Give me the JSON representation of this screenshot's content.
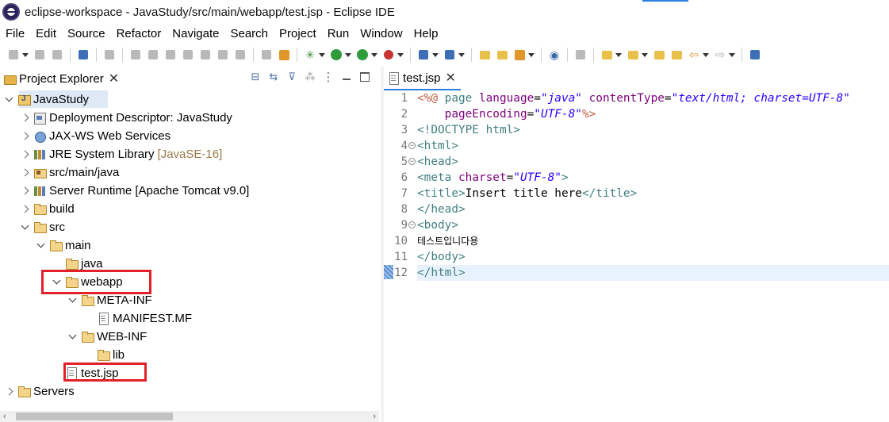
{
  "window": {
    "title": "eclipse-workspace - JavaStudy/src/main/webapp/test.jsp - Eclipse IDE"
  },
  "menu": [
    "File",
    "Edit",
    "Source",
    "Refactor",
    "Navigate",
    "Search",
    "Project",
    "Run",
    "Window",
    "Help"
  ],
  "project_explorer": {
    "tab_label": "Project Explorer",
    "tree": [
      {
        "label": "JavaStudy",
        "icon": "java-project-icon",
        "expanded": true,
        "selected": true
      },
      {
        "label": "Deployment Descriptor: JavaStudy",
        "icon": "deployment-descriptor-icon"
      },
      {
        "label": "JAX-WS Web Services",
        "icon": "web-services-icon"
      },
      {
        "label": "JRE System Library",
        "suffix": "[JavaSE-16]",
        "icon": "library-icon"
      },
      {
        "label": "src/main/java",
        "icon": "source-folder-icon"
      },
      {
        "label": "Server Runtime [Apache Tomcat v9.0]",
        "icon": "library-icon"
      },
      {
        "label": "build",
        "icon": "folder-icon"
      },
      {
        "label": "src",
        "icon": "folder-icon",
        "expanded": true
      },
      {
        "label": "main",
        "icon": "folder-icon",
        "expanded": true
      },
      {
        "label": "java",
        "icon": "folder-icon"
      },
      {
        "label": "webapp",
        "icon": "folder-icon",
        "expanded": true,
        "highlighted": true
      },
      {
        "label": "META-INF",
        "icon": "folder-icon",
        "expanded": true
      },
      {
        "label": "MANIFEST.MF",
        "icon": "file-icon"
      },
      {
        "label": "WEB-INF",
        "icon": "folder-icon",
        "expanded": true
      },
      {
        "label": "lib",
        "icon": "folder-icon"
      },
      {
        "label": "test.jsp",
        "icon": "jsp-file-icon",
        "highlighted": true
      },
      {
        "label": "Servers",
        "icon": "folder-icon"
      }
    ]
  },
  "editor": {
    "tab_label": "test.jsp",
    "current_line": 12,
    "line_numbers": [
      "1",
      "2",
      "3",
      "4",
      "5",
      "6",
      "7",
      "8",
      "9",
      "10",
      "11",
      "12"
    ],
    "code": {
      "l1_open": "<%@",
      "l1_page": " page ",
      "l1_lang_attr": "language",
      "l1_eq1": "=",
      "l1_lang_val": "\"java\"",
      "l1_ct_attr": " contentType",
      "l1_eq2": "=",
      "l1_ct_val": "\"text/html; charset=UTF-8\"",
      "l2_pe_attr": "    pageEncoding",
      "l2_eq": "=",
      "l2_pe_val": "\"UTF-8\"",
      "l2_close": "%>",
      "l3": "<!DOCTYPE html>",
      "l4": "<html>",
      "l5": "<head>",
      "l6_open": "<meta",
      "l6_attr": " charset",
      "l6_eq": "=",
      "l6_val": "\"UTF-8\"",
      "l6_close": ">",
      "l7_open": "<title>",
      "l7_text": "Insert title here",
      "l7_close": "</title>",
      "l8": "</head>",
      "l9": "<body>",
      "l10": "테스트입니다용",
      "l11": "</body>",
      "l12": "</html>"
    }
  },
  "colors": {
    "highlight_box": "#e2202a",
    "current_line": "#e8f2fe",
    "jsp_directive": "#bf5f3f",
    "tag": "#3f7f7f",
    "attribute": "#7f007f",
    "string": "#2a00ff"
  }
}
